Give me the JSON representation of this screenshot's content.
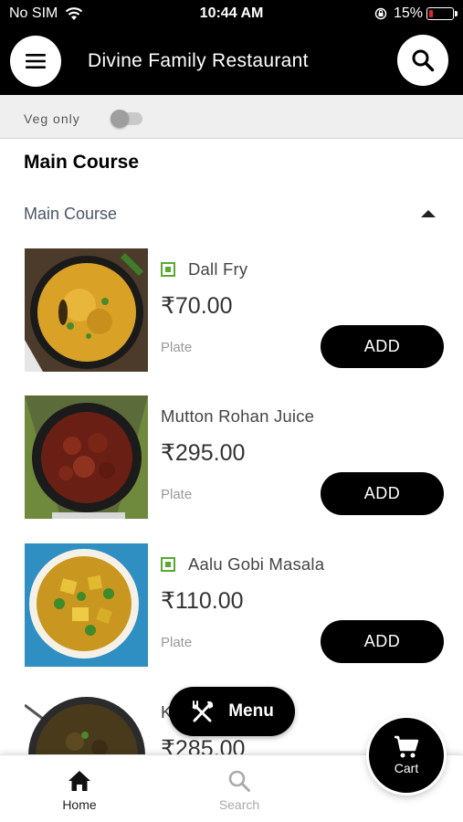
{
  "status": {
    "carrier": "No SIM",
    "time": "10:44 AM",
    "battery_pct": "15%",
    "battery_level": 0.15,
    "battery_color": "#e0252b"
  },
  "header": {
    "title": "Divine Family Restaurant",
    "menu_icon": "hamburger-icon",
    "search_icon": "search-icon"
  },
  "filter": {
    "veg_only_label": "Veg only",
    "veg_only_enabled": false
  },
  "section": {
    "title": "Main Course",
    "category_label": "Main Course",
    "expanded": true
  },
  "items": [
    {
      "name": "Dall Fry",
      "price": "₹70.00",
      "unit": "Plate",
      "veg": true,
      "add_label": "ADD"
    },
    {
      "name": "Mutton Rohan Juice",
      "price": "₹295.00",
      "unit": "Plate",
      "veg": false,
      "add_label": "ADD"
    },
    {
      "name": "Aalu Gobi Masala",
      "price": "₹110.00",
      "unit": "Plate",
      "veg": true,
      "add_label": "ADD"
    },
    {
      "name": "K",
      "price": "₹285.00",
      "unit": "",
      "veg": false,
      "add_label": ""
    }
  ],
  "floating_menu": {
    "label": "Menu",
    "icon": "fork-knife-icon"
  },
  "bottom_nav": {
    "home_label": "Home",
    "search_label": "Search",
    "cart_label": "Cart"
  },
  "colors": {
    "brand": "#000000",
    "veg_mark": "#5aa832",
    "category_text": "#4a5568"
  }
}
